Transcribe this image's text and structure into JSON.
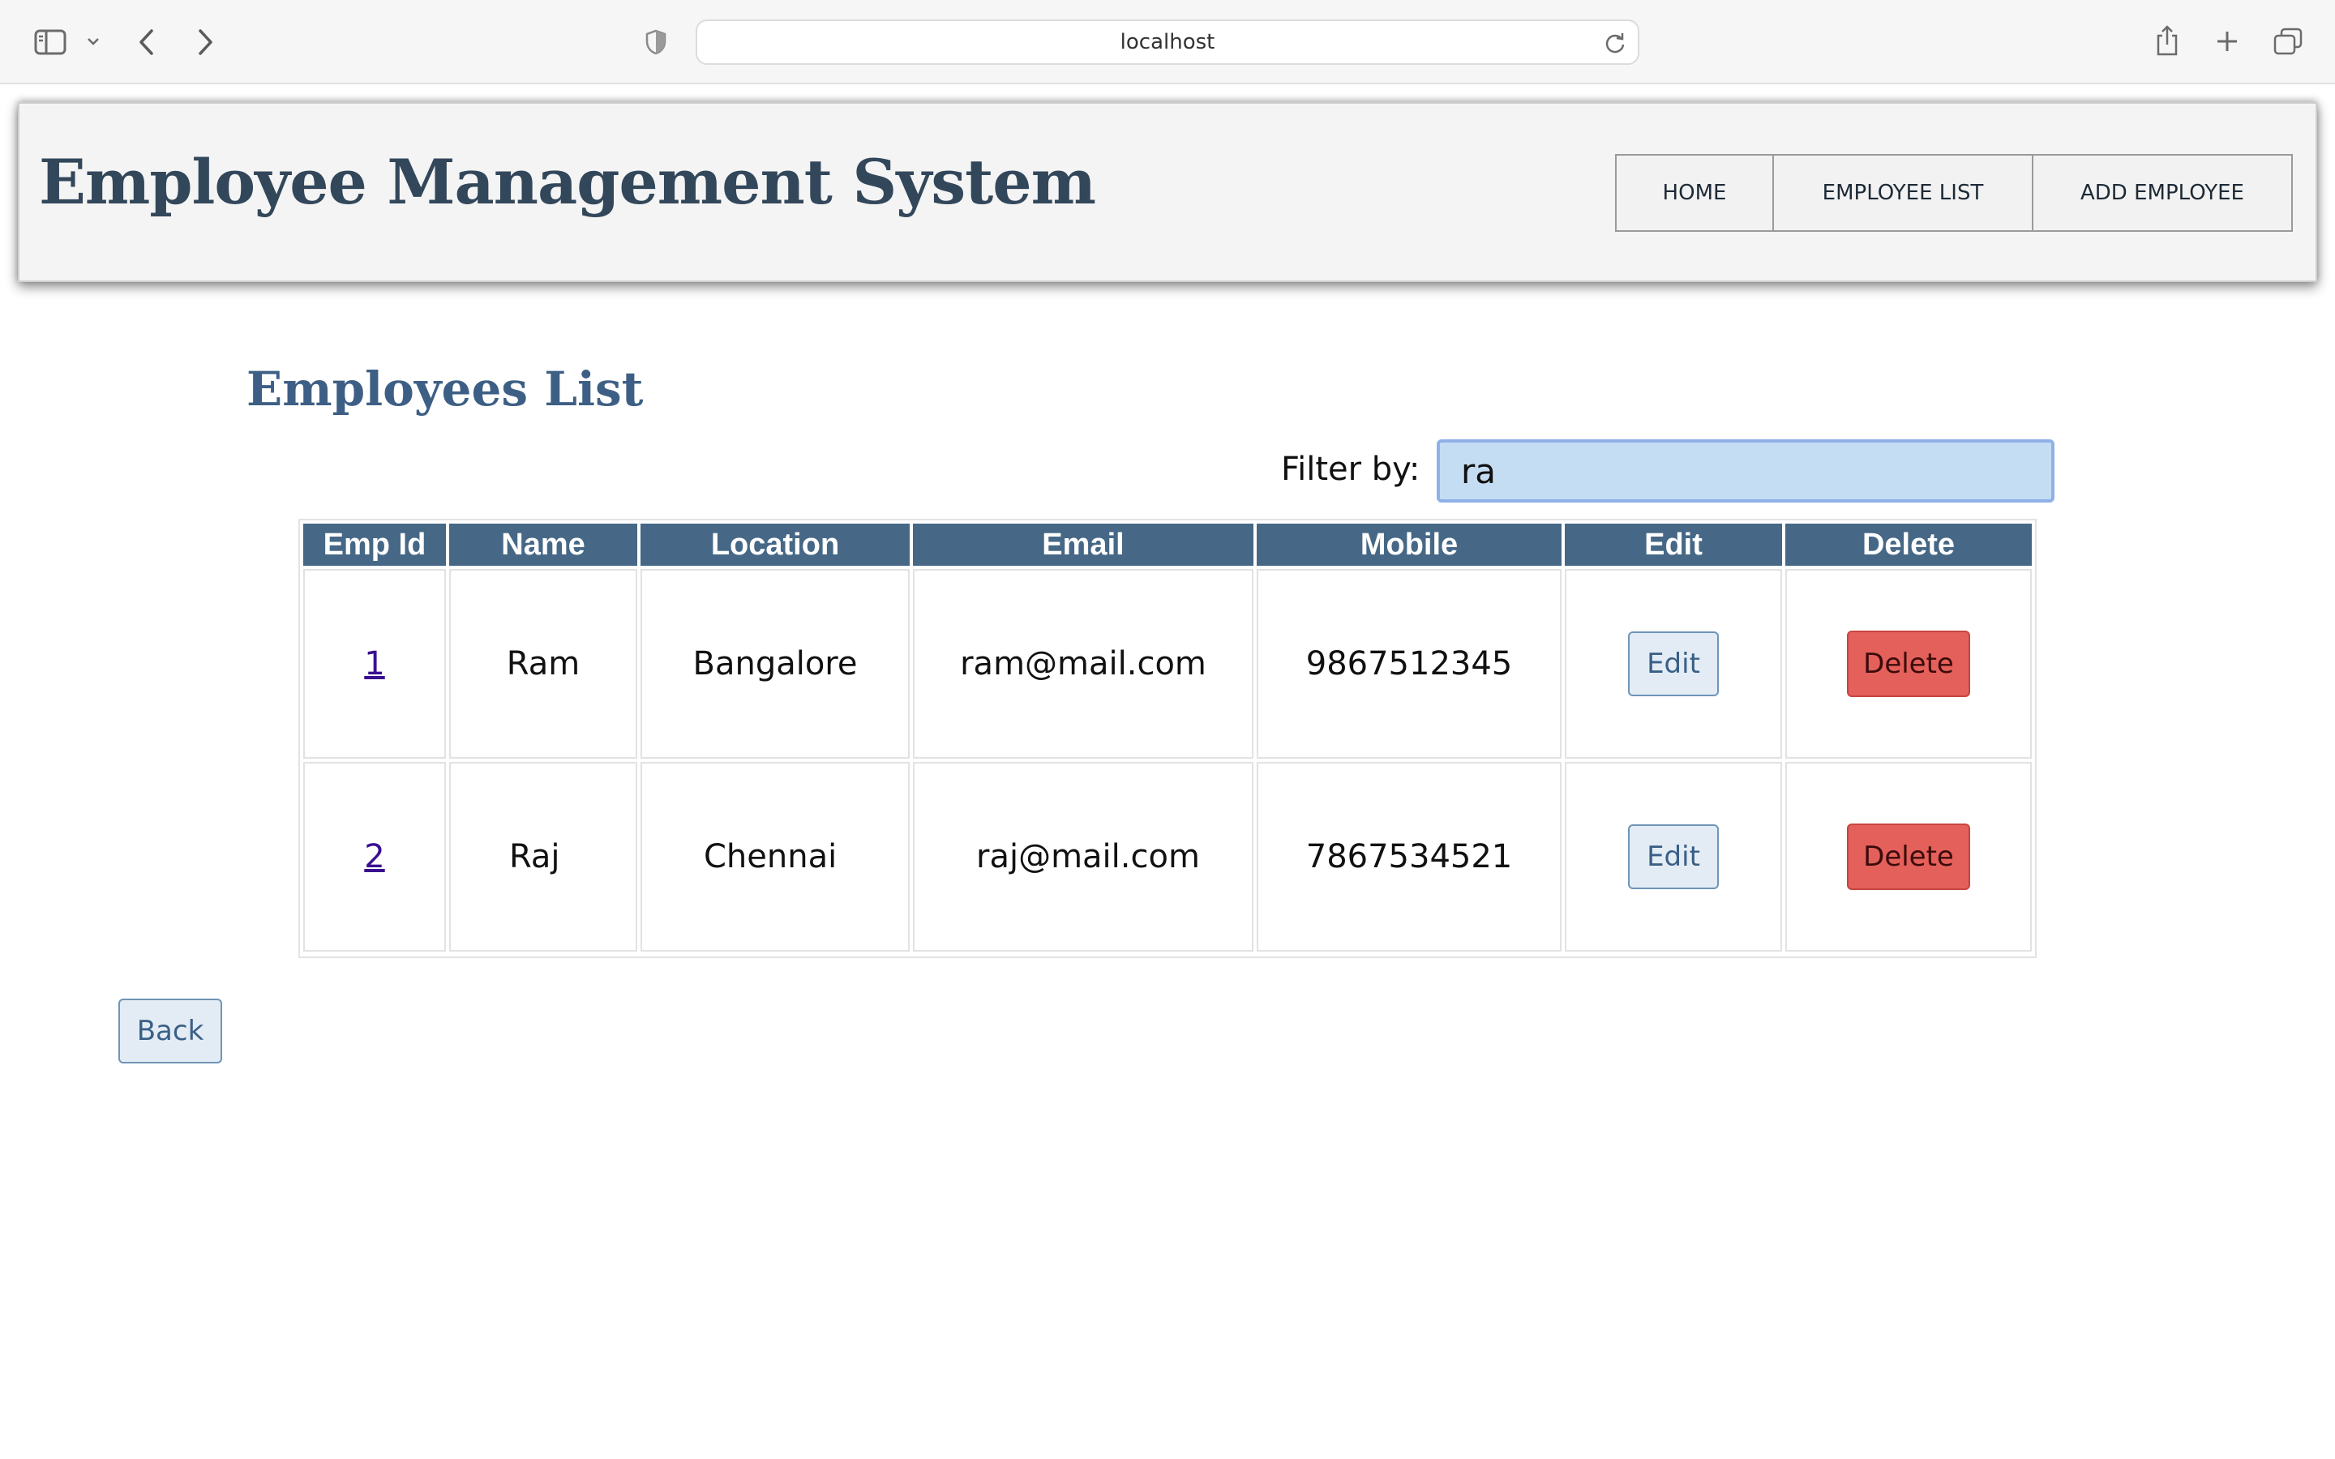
{
  "browser": {
    "url": "localhost",
    "icons": [
      "sidebar-icon",
      "chevron-down-icon",
      "back-arrow-icon",
      "forward-arrow-icon",
      "shield-icon",
      "reload-icon",
      "share-icon",
      "new-tab-icon",
      "tabs-overview-icon"
    ]
  },
  "header": {
    "title": "Employee Management System",
    "nav": [
      {
        "label": "HOME"
      },
      {
        "label": "EMPLOYEE LIST"
      },
      {
        "label": "ADD EMPLOYEE"
      }
    ]
  },
  "main": {
    "section_title": "Employees List",
    "filter": {
      "label": "Filter by:",
      "value": "ra"
    },
    "table": {
      "columns": [
        "Emp Id",
        "Name",
        "Location",
        "Email",
        "Mobile",
        "Edit",
        "Delete"
      ],
      "rows": [
        {
          "id": "1",
          "name": "Ram",
          "location": "Bangalore",
          "email": "ram@mail.com",
          "mobile": "9867512345",
          "edit_label": "Edit",
          "delete_label": "Delete"
        },
        {
          "id": "2",
          "name": "Raj",
          "location": "Chennai",
          "email": "raj@mail.com",
          "mobile": "7867534521",
          "edit_label": "Edit",
          "delete_label": "Delete"
        }
      ]
    },
    "back_label": "Back"
  },
  "colors": {
    "header_title": "#33475b",
    "section_title": "#3e5f85",
    "table_header_bg": "#466886",
    "delete_button": "#e4605a",
    "filter_bg": "#c5ddf3"
  }
}
